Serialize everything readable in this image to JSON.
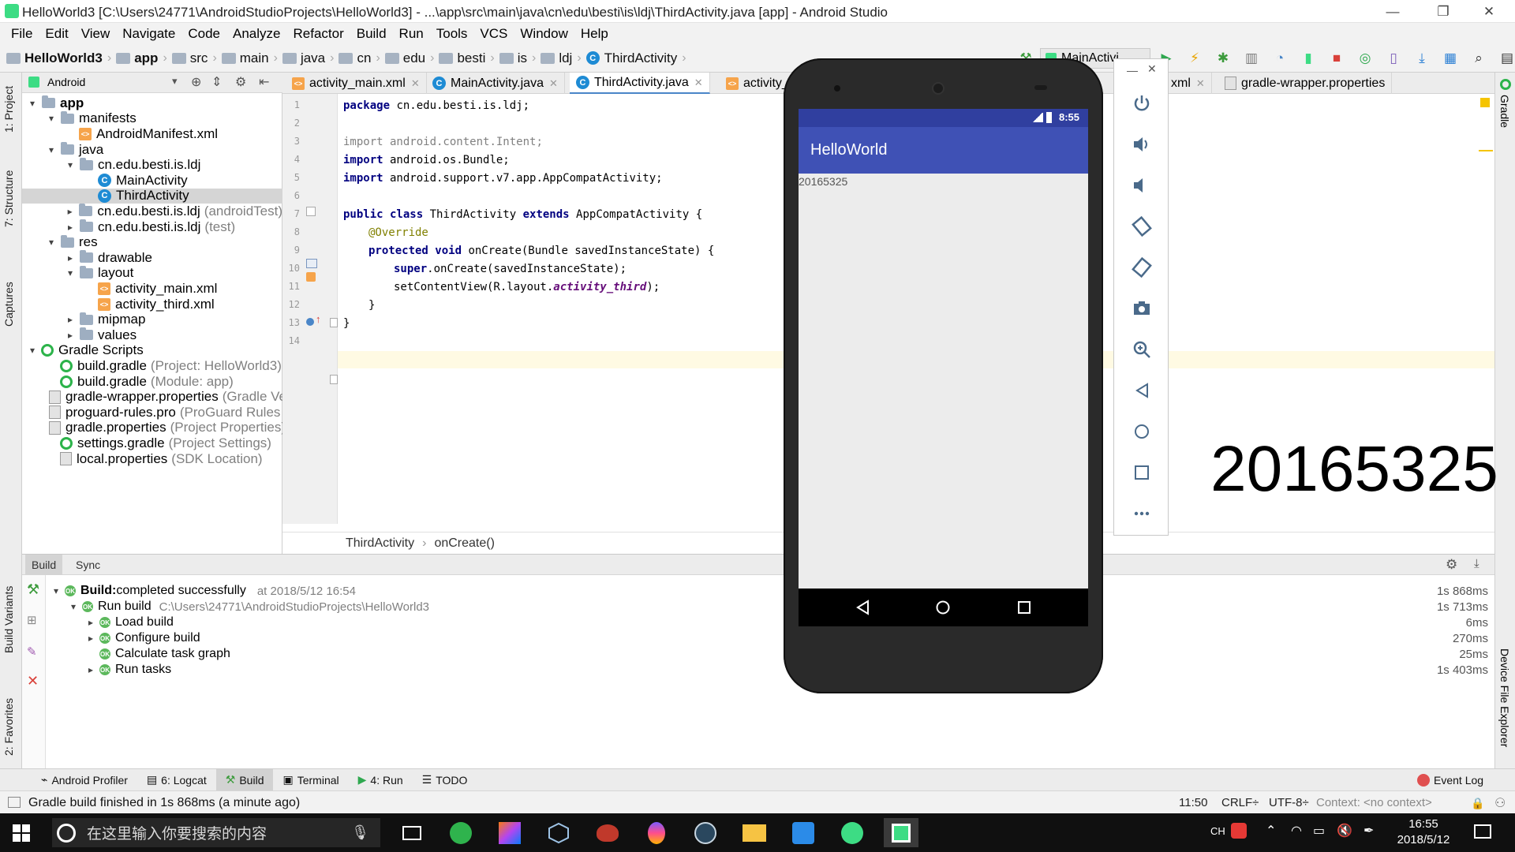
{
  "window": {
    "title": "HelloWorld3 [C:\\Users\\24771\\AndroidStudioProjects\\HelloWorld3] - ...\\app\\src\\main\\java\\cn\\edu\\besti\\is\\ldj\\ThirdActivity.java [app] - Android Studio",
    "min": "—",
    "restore": "❐",
    "close": "✕"
  },
  "menu": [
    "File",
    "Edit",
    "View",
    "Navigate",
    "Code",
    "Analyze",
    "Refactor",
    "Build",
    "Run",
    "Tools",
    "VCS",
    "Window",
    "Help"
  ],
  "breadcrumb": {
    "project": "HelloWorld3",
    "items": [
      "app",
      "src",
      "main",
      "java",
      "cn",
      "edu",
      "besti",
      "is",
      "ldj"
    ],
    "file": "ThirdActivity",
    "run_config": "MainActivi"
  },
  "project_panel": {
    "view": "Android",
    "tree": [
      {
        "label": "app",
        "icon": "folder",
        "arrow": "▾",
        "indent": 0,
        "bold": true
      },
      {
        "label": "manifests",
        "icon": "folder",
        "arrow": "▾",
        "indent": 1
      },
      {
        "label": "AndroidManifest.xml",
        "icon": "xml",
        "arrow": "",
        "indent": 2
      },
      {
        "label": "java",
        "icon": "folder",
        "arrow": "▾",
        "indent": 1
      },
      {
        "label": "cn.edu.besti.is.ldj",
        "icon": "folder",
        "arrow": "▾",
        "indent": 2
      },
      {
        "label": "MainActivity",
        "icon": "class",
        "arrow": "",
        "indent": 3
      },
      {
        "label": "ThirdActivity",
        "icon": "class",
        "arrow": "",
        "indent": 3,
        "selected": true
      },
      {
        "label": "cn.edu.besti.is.ldj",
        "hint": "(androidTest)",
        "icon": "folder",
        "arrow": "▸",
        "indent": 2
      },
      {
        "label": "cn.edu.besti.is.ldj",
        "hint": "(test)",
        "icon": "folder",
        "arrow": "▸",
        "indent": 2
      },
      {
        "label": "res",
        "icon": "folder",
        "arrow": "▾",
        "indent": 1
      },
      {
        "label": "drawable",
        "icon": "folder",
        "arrow": "▸",
        "indent": 2
      },
      {
        "label": "layout",
        "icon": "folder",
        "arrow": "▾",
        "indent": 2
      },
      {
        "label": "activity_main.xml",
        "icon": "xml",
        "arrow": "",
        "indent": 3
      },
      {
        "label": "activity_third.xml",
        "icon": "xml",
        "arrow": "",
        "indent": 3
      },
      {
        "label": "mipmap",
        "icon": "folder",
        "arrow": "▸",
        "indent": 2
      },
      {
        "label": "values",
        "icon": "folder",
        "arrow": "▸",
        "indent": 2
      },
      {
        "label": "Gradle Scripts",
        "icon": "gradle",
        "arrow": "▾",
        "indent": 0
      },
      {
        "label": "build.gradle",
        "hint": "(Project: HelloWorld3)",
        "icon": "gradle",
        "arrow": "",
        "indent": 1
      },
      {
        "label": "build.gradle",
        "hint": "(Module: app)",
        "icon": "gradle",
        "arrow": "",
        "indent": 1
      },
      {
        "label": "gradle-wrapper.properties",
        "hint": "(Gradle Ve",
        "icon": "prop",
        "arrow": "",
        "indent": 1
      },
      {
        "label": "proguard-rules.pro",
        "hint": "(ProGuard Rules fo",
        "icon": "prop",
        "arrow": "",
        "indent": 1
      },
      {
        "label": "gradle.properties",
        "hint": "(Project Properties)",
        "icon": "prop",
        "arrow": "",
        "indent": 1
      },
      {
        "label": "settings.gradle",
        "hint": "(Project Settings)",
        "icon": "gradle",
        "arrow": "",
        "indent": 1
      },
      {
        "label": "local.properties",
        "hint": "(SDK Location)",
        "icon": "prop",
        "arrow": "",
        "indent": 1
      }
    ]
  },
  "editor": {
    "tabs": [
      "activity_main.xml",
      "MainActivity.java",
      "ThirdActivity.java",
      "activity_",
      "xml",
      "gradle-wrapper.properties"
    ],
    "active_tab": "ThirdActivity.java",
    "line_numbers": [
      "1",
      "2",
      "3",
      "4",
      "5",
      "6",
      "7",
      "8",
      "9",
      "10",
      "11",
      "12",
      "13",
      "14"
    ],
    "code": {
      "l1_kw": "package",
      "l1_rest": " cn.edu.besti.is.ldj;",
      "l3_kw": "import",
      "l3_rest": " android.content.Intent;",
      "l4_kw": "import",
      "l4_rest": " android.os.Bundle;",
      "l5_kw": "import",
      "l5_rest": " android.support.v7.app.AppCompatActivity;",
      "l7_kw1": "public class",
      "l7_mid": " ThirdActivity ",
      "l7_kw2": "extends",
      "l7_rest": " AppCompatActivity {",
      "l8": "@Override",
      "l9_kw": "protected void",
      "l9_rest": " onCreate(Bundle savedInstanceState) {",
      "l10_kw": "super",
      "l10_rest": ".onCreate(savedInstanceState);",
      "l11_a": "setContentView(R.layout.",
      "l11_it": "activity_third",
      "l11_b": ");",
      "l12": "}",
      "l13": "}"
    },
    "breadcrumb": [
      "ThirdActivity",
      "onCreate()"
    ]
  },
  "build_panel": {
    "tabs": [
      "Build",
      "Sync"
    ],
    "rows": [
      {
        "label": "Build:",
        "text": " completed successfully",
        "meta": "at 2018/5/12 16:54",
        "duration": "1s 868ms"
      },
      {
        "label": "Run build",
        "meta": "C:\\Users\\24771\\AndroidStudioProjects\\HelloWorld3",
        "duration": "1s 713ms"
      },
      {
        "label": "Load build",
        "duration": "6ms"
      },
      {
        "label": "Configure build",
        "duration": "270ms"
      },
      {
        "label": "Calculate task graph",
        "duration": "25ms"
      },
      {
        "label": "Run tasks",
        "duration": "1s 403ms"
      }
    ]
  },
  "tool_windows": [
    {
      "label": "Android Profiler",
      "icon": "⌁"
    },
    {
      "label": "6: Logcat",
      "icon": "▤"
    },
    {
      "label": "Build",
      "icon": "⚒",
      "active": true
    },
    {
      "label": "Terminal",
      "icon": "▣"
    },
    {
      "label": "4: Run",
      "icon": "▶"
    },
    {
      "label": "TODO",
      "icon": "☰"
    }
  ],
  "event_log": "Event Log",
  "side_tabs": {
    "left": [
      "1: Project",
      "7: Structure",
      "Captures",
      "Build Variants",
      "2: Favorites"
    ],
    "right": [
      "Gradle",
      "Device File Explorer"
    ]
  },
  "status": {
    "message": "Gradle build finished in 1s 868ms (a minute ago)",
    "position": "11:50",
    "line_sep": "CRLF÷",
    "encoding": "UTF-8÷",
    "context": "Context: <no context>"
  },
  "emulator": {
    "time": "8:55",
    "app_title": "HelloWorld",
    "content_text": "20165325",
    "big_overlay": "20165325"
  },
  "taskbar": {
    "search_placeholder": "在这里输入你要搜索的内容",
    "ime": "CH",
    "time": "16:55",
    "date": "2018/5/12"
  },
  "colors": {
    "primary": "#3f51b5",
    "primary_dark": "#303f9f",
    "ok": "#5cb85c",
    "accent": "#4a86c8"
  }
}
